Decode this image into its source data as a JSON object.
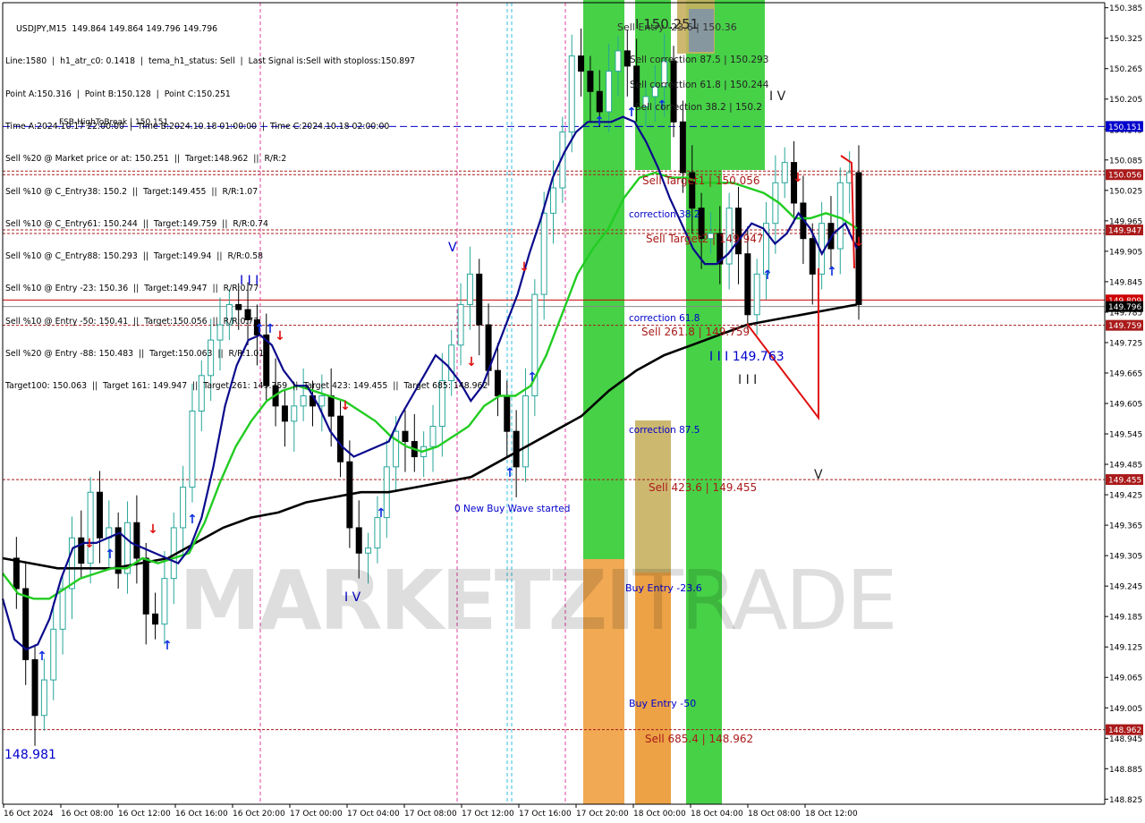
{
  "symbol_line": "USDJPY,M15  149.864 149.864 149.796 149.796",
  "info_lines": [
    "Line:1580  |  h1_atr_c0: 0.1418  |  tema_h1_status: Sell  |  Last Signal is:Sell with stoploss:150.897",
    "Sell %20 @ Market price or at: 150.251  ||  Target:148.962  ||  R/R:2",
    "Sell %10 @ C_Entry38: 150.2  ||  Target:149.455  ||  R/R:1.07",
    "Sell %10 @ C_Entry61: 150.244  ||  Target:149.759  ||  R/R:0.74",
    "Sell %10 @ C_Entry88: 150.293  ||  Target:149.94  ||  R/R:0.58",
    "Sell %10 @ Entry -23: 150.36  ||  Target:149.947  ||  R/R:0.77",
    "Sell %10 @ Entry -50: 150.41  ||  Target:150.056  ||  R/R:0.73",
    "Sell %20 @ Entry -88: 150.483  ||  Target:150.063  ||  R/R:1.01",
    "Target100: 150.063  ||  Target 161: 149.947  ||  Target 261: 149.759  ||  Target 423: 149.455  ||  Target 685: 148.962"
  ],
  "header": {
    "time_line": "Time A:2024.10.17 22:00:00  |  Time B:2024.10.18 01:00:00  |  Time C:2024.10.18 02:00:00",
    "point_line": "Point A:150.316  |  Point B:150.128  |  Point C:150.251"
  },
  "watermark": {
    "part1": "MARKETZI",
    "part2": "TRADE"
  },
  "colors": {
    "bg": "#ffffff",
    "candle_up": "#26a69a",
    "candle_down": "#000000",
    "ema_blue": "#0a0a8c",
    "ema_green": "#22cc22",
    "ema_black": "#000000",
    "res_red": "#cc0000",
    "current": "#000000",
    "zone_green": "#33cc33",
    "zone_orange": "#f0a040",
    "zone_tan": "#c8b060",
    "label_blue": "#0000cc",
    "label_red": "#aa1a1a",
    "arrow_blue": "#1030e0",
    "arrow_red": "#e01010"
  },
  "chart_data": {
    "type": "candlestick",
    "symbol": "USDJPY",
    "timeframe": "M15",
    "ylim": [
      148.815,
      150.395
    ],
    "y_ticks": [
      "150.385",
      "150.325",
      "150.265",
      "150.205",
      "150.145",
      "150.085",
      "150.025",
      "149.965",
      "149.905",
      "149.845",
      "149.785",
      "149.725",
      "149.665",
      "149.605",
      "149.545",
      "149.485",
      "149.425",
      "149.365",
      "149.305",
      "149.245",
      "149.185",
      "149.125",
      "149.065",
      "149.005",
      "148.945",
      "148.885",
      "148.825"
    ],
    "x_ticks": [
      "16 Oct 2024",
      "16 Oct 08:00",
      "16 Oct 12:00",
      "16 Oct 16:00",
      "16 Oct 20:00",
      "17 Oct 00:00",
      "17 Oct 04:00",
      "17 Oct 08:00",
      "17 Oct 12:00",
      "17 Oct 16:00",
      "17 Oct 20:00",
      "18 Oct 00:00",
      "18 Oct 04:00",
      "18 Oct 08:00",
      "18 Oct 12:00"
    ],
    "price_tags": [
      {
        "value": 150.151,
        "label": "150.151",
        "color": "#0000cc"
      },
      {
        "value": 150.056,
        "label": "150.056",
        "color": "#aa1a1a"
      },
      {
        "value": 149.947,
        "label": "149.947",
        "color": "#aa1a1a"
      },
      {
        "value": 149.809,
        "label": "149.809",
        "color": "#cc0000"
      },
      {
        "value": 149.796,
        "label": "149.796",
        "color": "#000000"
      },
      {
        "value": 149.759,
        "label": "149.759",
        "color": "#aa1a1a"
      },
      {
        "value": 149.455,
        "label": "149.455",
        "color": "#aa1a1a"
      },
      {
        "value": 148.962,
        "label": "148.962",
        "color": "#aa1a1a"
      }
    ],
    "levels": [
      {
        "value": 150.151,
        "style": "dashed",
        "color": "#0000cc"
      },
      {
        "value": 150.063,
        "style": "dotted",
        "color": "#aa1a1a"
      },
      {
        "value": 150.056,
        "style": "dotted",
        "color": "#aa1a1a"
      },
      {
        "value": 149.947,
        "style": "dotted",
        "color": "#aa1a1a"
      },
      {
        "value": 149.94,
        "style": "dotted",
        "color": "#aa1a1a"
      },
      {
        "value": 149.809,
        "style": "solid",
        "color": "#cc0000"
      },
      {
        "value": 149.796,
        "style": "solid",
        "color": "#888888"
      },
      {
        "value": 149.759,
        "style": "dotted",
        "color": "#aa1a1a"
      },
      {
        "value": 149.455,
        "style": "dotted",
        "color": "#aa1a1a"
      },
      {
        "value": 148.962,
        "style": "dotted",
        "color": "#aa1a1a"
      }
    ],
    "key_points": [
      {
        "name": "Point A",
        "time": "2024.10.17 22:00:00",
        "price": 150.316
      },
      {
        "name": "Point B",
        "time": "2024.10.18 01:00:00",
        "price": 150.128
      },
      {
        "name": "Point C",
        "time": "2024.10.18 02:00:00",
        "price": 150.251
      }
    ],
    "close_series": [
      149.3,
      149.24,
      149.1,
      148.99,
      149.06,
      149.16,
      149.24,
      149.34,
      149.29,
      149.43,
      149.34,
      149.36,
      149.27,
      149.37,
      149.3,
      149.19,
      149.17,
      149.26,
      149.36,
      149.44,
      149.59,
      149.66,
      149.73,
      149.76,
      149.8,
      149.79,
      149.77,
      149.74,
      149.64,
      149.6,
      149.57,
      149.6,
      149.62,
      149.6,
      149.62,
      149.58,
      149.49,
      149.36,
      149.31,
      149.32,
      149.38,
      149.48,
      149.55,
      149.53,
      149.5,
      149.52,
      149.56,
      149.65,
      149.72,
      149.8,
      149.86,
      149.76,
      149.67,
      149.62,
      149.55,
      149.48,
      149.62,
      149.82,
      149.98,
      150.03,
      150.14,
      150.29,
      150.26,
      150.22,
      150.18,
      150.26,
      150.3,
      150.27,
      150.19,
      150.21,
      150.23,
      150.28,
      150.16,
      150.06,
      149.99,
      149.93,
      149.94,
      149.88,
      149.99,
      149.9,
      149.78,
      149.86,
      149.96,
      150.04,
      150.08,
      150.0,
      149.93,
      149.86,
      149.96,
      149.91,
      150.04,
      150.06,
      149.8
    ],
    "series": [
      {
        "name": "ema_blue",
        "values": [
          149.22,
          149.14,
          149.12,
          149.13,
          149.18,
          149.26,
          149.32,
          149.33,
          149.33,
          149.34,
          149.35,
          149.33,
          149.32,
          149.31,
          149.3,
          149.29,
          149.32,
          149.38,
          149.48,
          149.6,
          149.68,
          149.73,
          149.74,
          149.72,
          149.67,
          149.64,
          149.64,
          149.6,
          149.55,
          149.52,
          149.5,
          149.51,
          149.52,
          149.53,
          149.58,
          149.62,
          149.66,
          149.7,
          149.68,
          149.65,
          149.61,
          149.64,
          149.7,
          149.76,
          149.82,
          149.9,
          149.97,
          150.05,
          150.1,
          150.14,
          150.16,
          150.16,
          150.16,
          150.17,
          150.16,
          150.12,
          150.07,
          150.01,
          149.96,
          149.91,
          149.88,
          149.88,
          149.9,
          149.93,
          149.96,
          149.95,
          149.92,
          149.94,
          149.98,
          149.95,
          149.9,
          149.94,
          149.96,
          149.91
        ]
      },
      {
        "name": "ema_green",
        "values": [
          149.27,
          149.23,
          149.22,
          149.22,
          149.24,
          149.26,
          149.27,
          149.28,
          149.28,
          149.3,
          149.29,
          149.3,
          149.31,
          149.37,
          149.45,
          149.52,
          149.57,
          149.61,
          149.63,
          149.64,
          149.63,
          149.62,
          149.61,
          149.59,
          149.57,
          149.54,
          149.52,
          149.51,
          149.52,
          149.54,
          149.56,
          149.6,
          149.62,
          149.62,
          149.64,
          149.7,
          149.78,
          149.86,
          149.91,
          149.95,
          150.01,
          150.05,
          150.06,
          150.05,
          150.05,
          150.04,
          150.04,
          150.04,
          150.03,
          150.02,
          150.0,
          149.97,
          149.97,
          149.98,
          149.97,
          149.95
        ]
      },
      {
        "name": "ema_black",
        "values": [
          149.3,
          149.29,
          149.28,
          149.28,
          149.28,
          149.29,
          149.3,
          149.33,
          149.36,
          149.38,
          149.39,
          149.41,
          149.42,
          149.43,
          149.43,
          149.44,
          149.45,
          149.46,
          149.49,
          149.52,
          149.55,
          149.58,
          149.63,
          149.67,
          149.7,
          149.72,
          149.74,
          149.76,
          149.77,
          149.78,
          149.79,
          149.8
        ]
      }
    ]
  },
  "annotations": {
    "top_label": "I  150.251",
    "sell_entry": "Sell Entry -23.6 | 150.36",
    "corr875": "Sell correction 87.5 | 150.293",
    "corr618": "Sell correction 61.8 | 150.244",
    "corr382": "Sell correction 38.2 | 150.2",
    "fsb": "FSB-HighToBreak | 150.151",
    "sell_target1": "Sell Target1 | 150.056",
    "sell_target2": "Sell Target2 | 149.947",
    "correction382": "correction 38.2",
    "correction618": "correction 61.8",
    "correction875": "correction 87.5",
    "sell2618": "Sell 261.8 | 149.759",
    "sell4236": "Sell 423.6 | 149.455",
    "sell6854": "Sell 685.4 | 148.962",
    "buy236": "Buy Entry -23.6",
    "buy50": "Buy Entry -50",
    "new_wave": "0 New Buy Wave started",
    "wave_iii_price": "I I I  149.763",
    "low_label": "148.981",
    "wave_III_1": "I I I",
    "wave_V_1": "V",
    "wave_IV_1": "I V",
    "wave_IV_2": "I V",
    "wave_III_2": "I I I",
    "wave_V_2": "V"
  }
}
